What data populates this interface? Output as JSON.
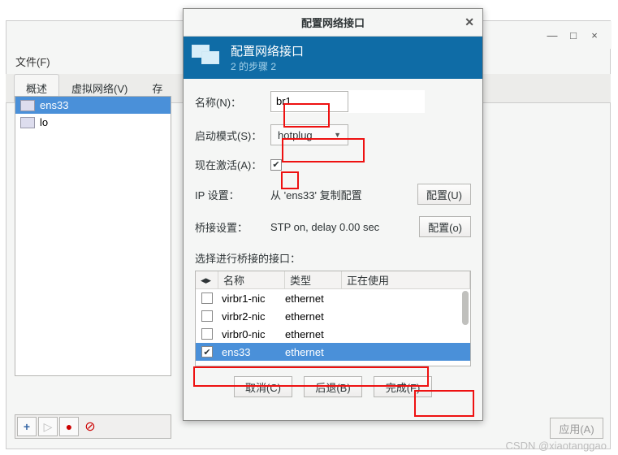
{
  "bg_window": {
    "menubar": "文件(F)",
    "tabs": {
      "overview": "概述",
      "virtnet": "虚拟网络(V)",
      "storage_prefix": "存"
    },
    "interfaces": {
      "ens33": "ens33",
      "lo": "lo"
    },
    "apply": "应用(A)"
  },
  "dialog": {
    "title": "配置网络接口",
    "banner": {
      "title": "配置网络接口",
      "subtitle": "2 的步骤 2"
    },
    "labels": {
      "name": "名称(N)：",
      "startmode": "启动模式(S)：",
      "activate": "现在激活(A)：",
      "ipsettings": "IP 设置：",
      "bridge": "桥接设置：",
      "select_if": "选择进行桥接的接口："
    },
    "values": {
      "name": "br1",
      "startmode": "hotplug",
      "ip_copy": "从 'ens33' 复制配置",
      "bridge_status": "STP on, delay 0.00 sec"
    },
    "buttons": {
      "config_u": "配置(U)",
      "config_o": "配置(o)",
      "cancel": "取消(C)",
      "back": "后退(B)",
      "finish": "完成(F)"
    },
    "grid": {
      "headers": {
        "name": "名称",
        "type": "类型",
        "inuse": "正在使用"
      },
      "rows": [
        {
          "checked": false,
          "name": "virbr1-nic",
          "type": "ethernet",
          "selected": false
        },
        {
          "checked": false,
          "name": "virbr2-nic",
          "type": "ethernet",
          "selected": false
        },
        {
          "checked": false,
          "name": "virbr0-nic",
          "type": "ethernet",
          "selected": false
        },
        {
          "checked": true,
          "name": "ens33",
          "type": "ethernet",
          "selected": true
        }
      ]
    }
  },
  "watermark": "CSDN @xiaotanggao",
  "chart_data": {
    "type": "table",
    "note": "interface selection grid; see dialog.grid"
  }
}
